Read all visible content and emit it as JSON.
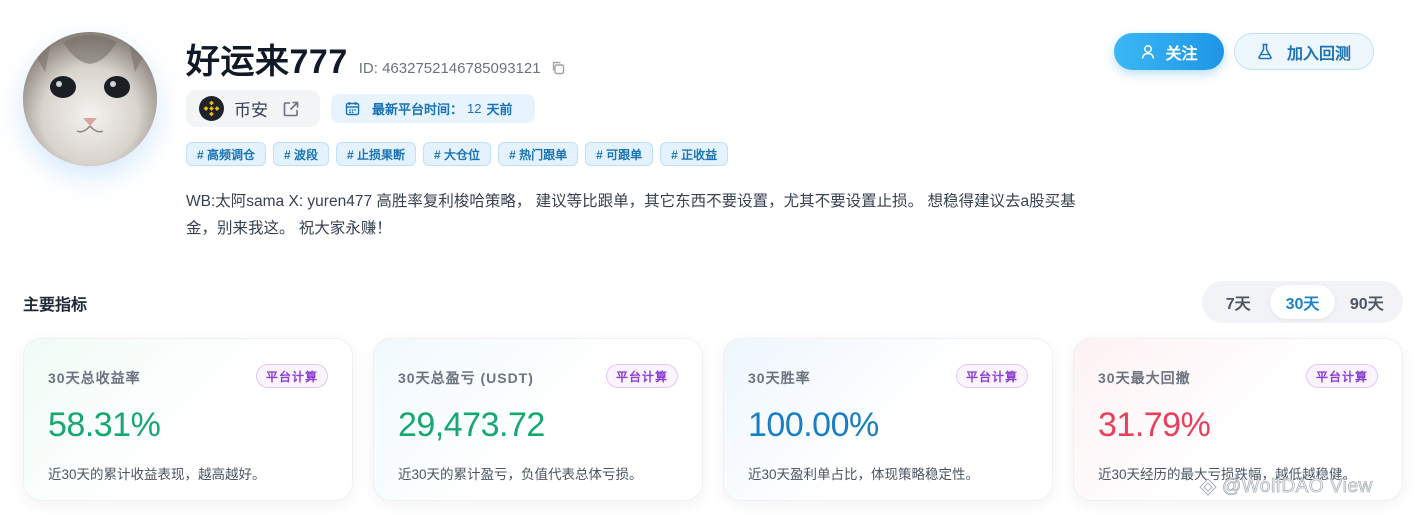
{
  "profile": {
    "name": "好运来777",
    "id_text": "ID: 4632752146785093121",
    "exchange": "币安",
    "last_active_label": "最新平台时间：",
    "last_active_value": "12",
    "last_active_unit": "天前",
    "tags": [
      "# 高频调仓",
      "# 波段",
      "# 止损果断",
      "# 大仓位",
      "# 热门跟单",
      "# 可跟单",
      "# 正收益"
    ],
    "description": "WB:太阿sama X: yuren477 高胜率复利梭哈策略， 建议等比跟单，其它东西不要设置，尤其不要设置止损。 想稳得建议去a股买基金，别来我这。 祝大家永赚！"
  },
  "actions": {
    "follow_label": "关注",
    "backtest_label": "加入回测"
  },
  "metrics": {
    "title": "主要指标",
    "periods": [
      "7天",
      "30天",
      "90天"
    ],
    "active_period": "30天",
    "badge": "平台计算",
    "cards": [
      {
        "label": "30天总收益率",
        "value": "58.31%",
        "note": "近30天的累计收益表现，越高越好。",
        "color": "#16a870"
      },
      {
        "label": "30天总盈亏 (USDT)",
        "value": "29,473.72",
        "note": "近30天的累计盈亏，负值代表总体亏损。",
        "color": "#16a870"
      },
      {
        "label": "30天胜率",
        "value": "100.00%",
        "note": "近30天盈利单占比，体现策略稳定性。",
        "color": "#1a7fc1"
      },
      {
        "label": "30天最大回撤",
        "value": "31.79%",
        "note": "近30天经历的最大亏损跌幅，越低越稳健。",
        "color": "#e8405c"
      }
    ]
  },
  "watermark": "@WolfDAO View"
}
